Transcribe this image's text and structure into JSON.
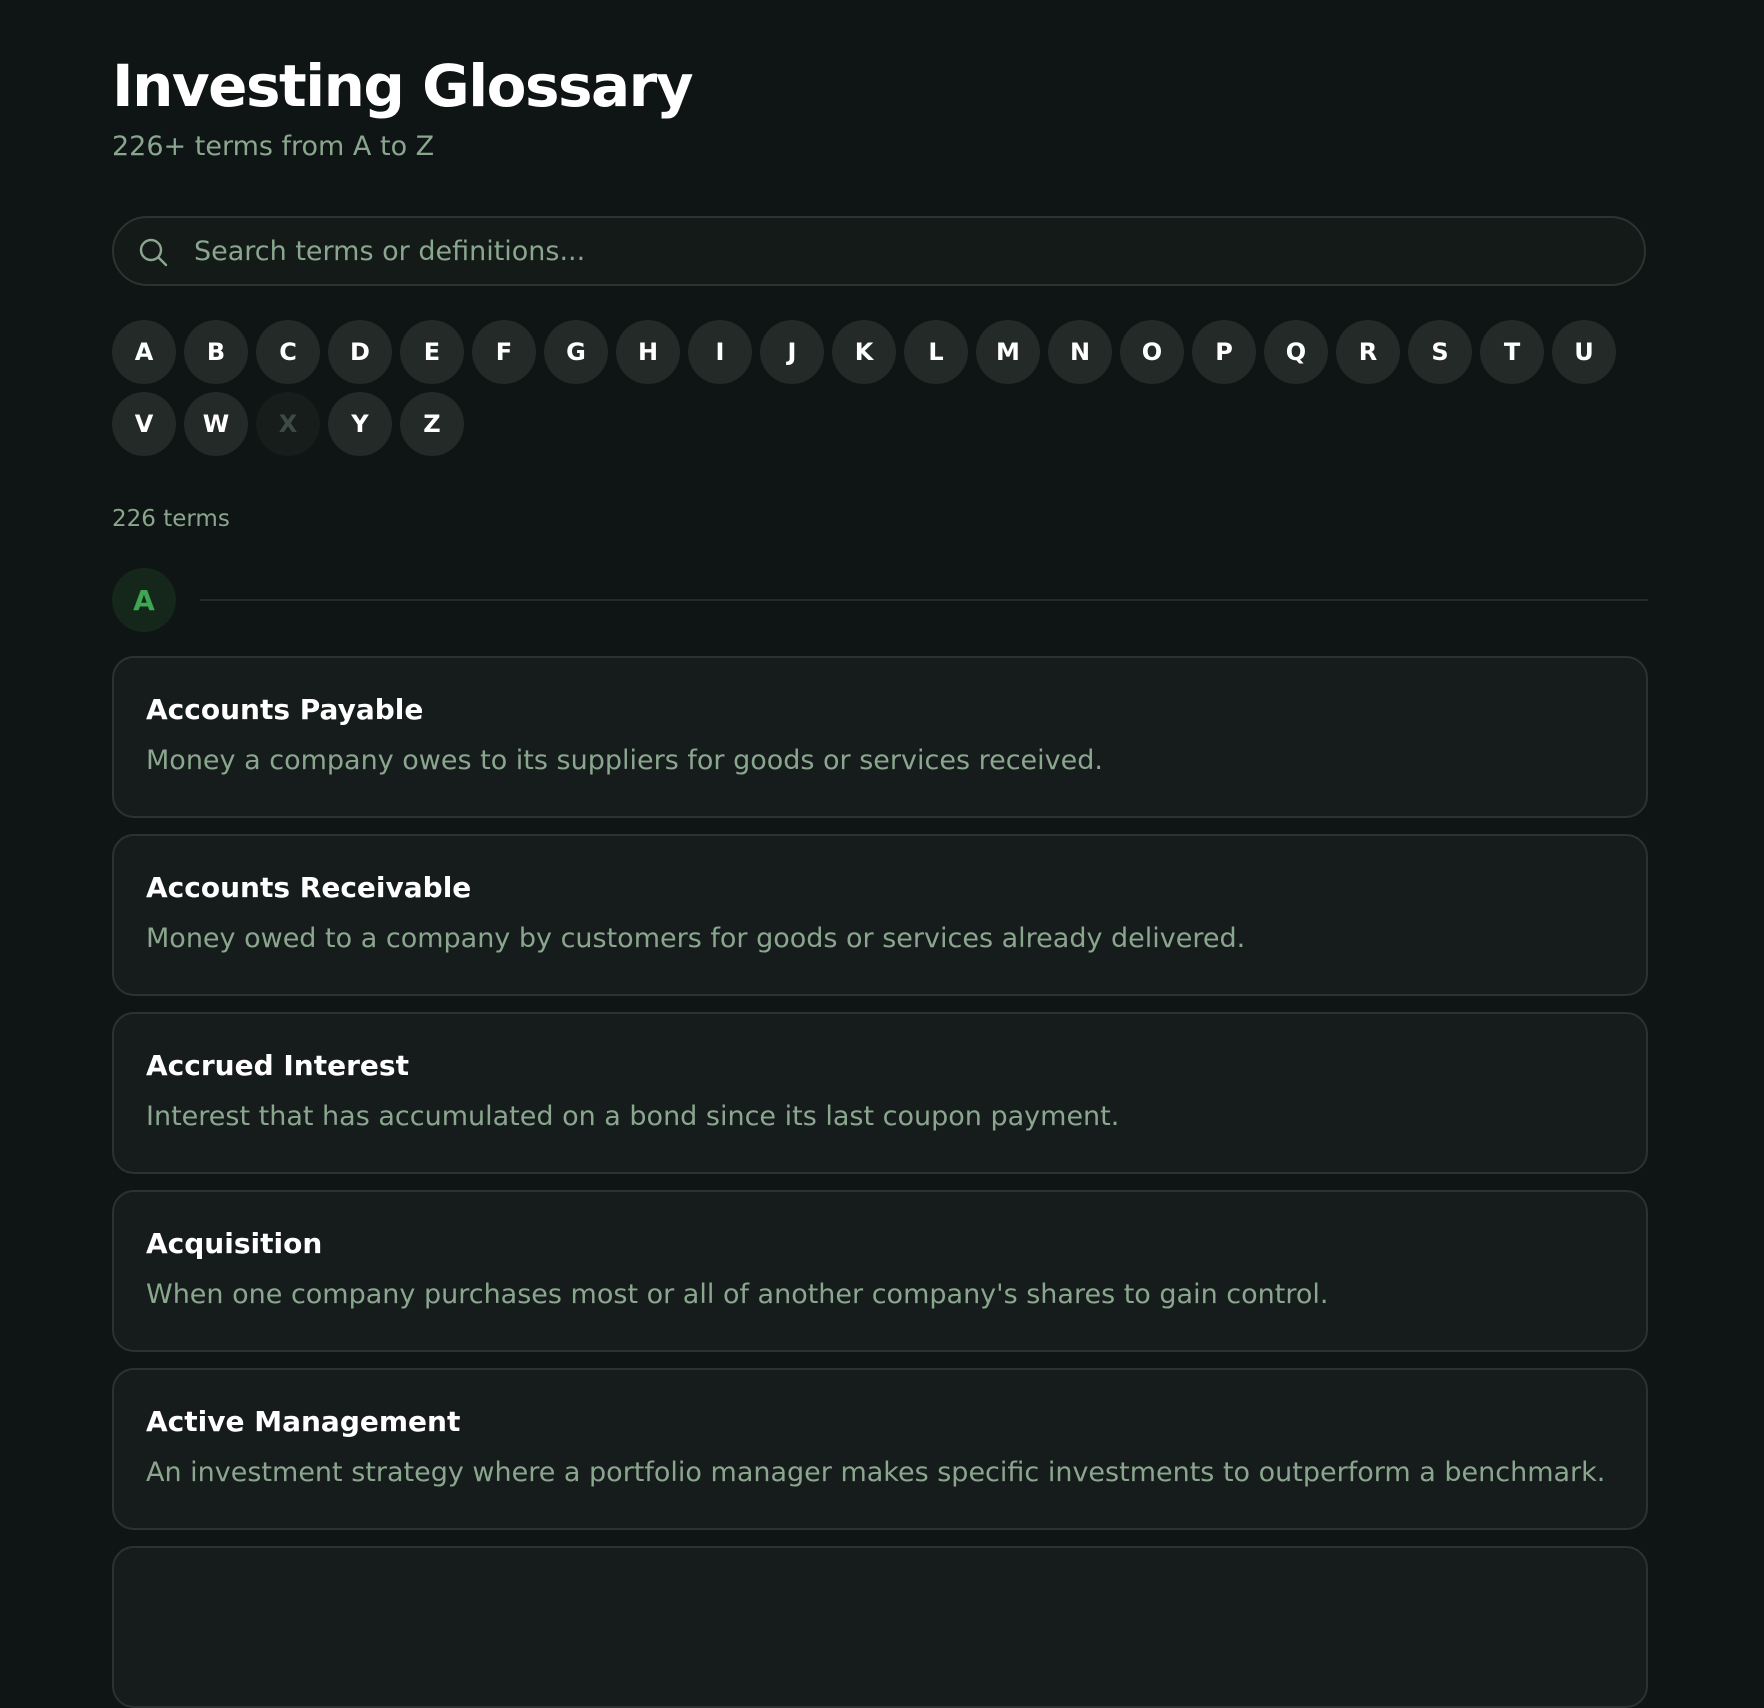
{
  "header": {
    "title": "Investing Glossary",
    "subtitle": "226+ terms from A to Z"
  },
  "search": {
    "placeholder": "Search terms or definitions...",
    "value": "",
    "icon": "search-icon"
  },
  "letter_nav": [
    {
      "letter": "A",
      "enabled": true
    },
    {
      "letter": "B",
      "enabled": true
    },
    {
      "letter": "C",
      "enabled": true
    },
    {
      "letter": "D",
      "enabled": true
    },
    {
      "letter": "E",
      "enabled": true
    },
    {
      "letter": "F",
      "enabled": true
    },
    {
      "letter": "G",
      "enabled": true
    },
    {
      "letter": "H",
      "enabled": true
    },
    {
      "letter": "I",
      "enabled": true
    },
    {
      "letter": "J",
      "enabled": true
    },
    {
      "letter": "K",
      "enabled": true
    },
    {
      "letter": "L",
      "enabled": true
    },
    {
      "letter": "M",
      "enabled": true
    },
    {
      "letter": "N",
      "enabled": true
    },
    {
      "letter": "O",
      "enabled": true
    },
    {
      "letter": "P",
      "enabled": true
    },
    {
      "letter": "Q",
      "enabled": true
    },
    {
      "letter": "R",
      "enabled": true
    },
    {
      "letter": "S",
      "enabled": true
    },
    {
      "letter": "T",
      "enabled": true
    },
    {
      "letter": "U",
      "enabled": true
    },
    {
      "letter": "V",
      "enabled": true
    },
    {
      "letter": "W",
      "enabled": true
    },
    {
      "letter": "X",
      "enabled": false
    },
    {
      "letter": "Y",
      "enabled": true
    },
    {
      "letter": "Z",
      "enabled": true
    }
  ],
  "results": {
    "count_label": "226 terms"
  },
  "section": {
    "letter": "A",
    "terms": [
      {
        "name": "Accounts Payable",
        "definition": "Money a company owes to its suppliers for goods or services received."
      },
      {
        "name": "Accounts Receivable",
        "definition": "Money owed to a company by customers for goods or services already delivered."
      },
      {
        "name": "Accrued Interest",
        "definition": "Interest that has accumulated on a bond since its last coupon payment."
      },
      {
        "name": "Acquisition",
        "definition": "When one company purchases most or all of another company's shares to gain control."
      },
      {
        "name": "Active Management",
        "definition": "An investment strategy where a portfolio manager makes specific investments to outperform a benchmark."
      },
      {
        "name": "",
        "definition": ""
      }
    ]
  },
  "colors": {
    "background": "#0f1514",
    "card": "#161c1b",
    "muted_text": "#8ba68f",
    "accent": "#3fa653",
    "letter_button": "#232a28"
  }
}
